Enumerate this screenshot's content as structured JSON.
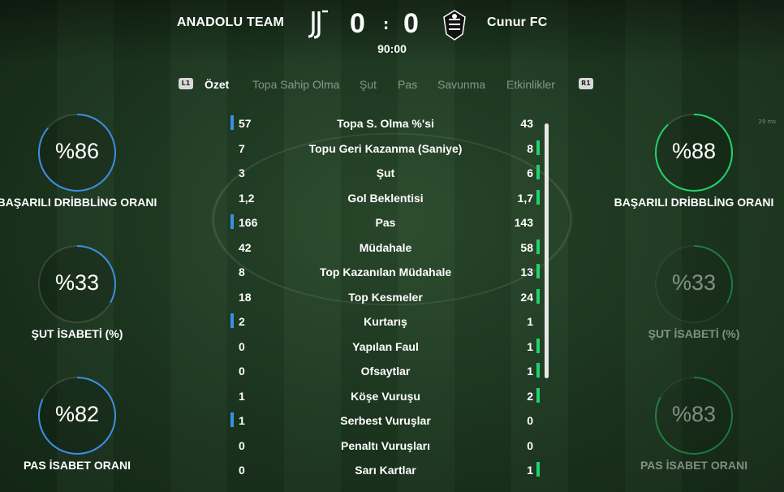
{
  "header": {
    "home_team": "ANADOLU TEAM",
    "away_team": "Cunur FC",
    "home_score": "0",
    "away_score": "0",
    "separator": ":",
    "clock": "90:00"
  },
  "tabs": {
    "bumper_left": "L1",
    "bumper_right": "R1",
    "items": [
      "Özet",
      "Topa Sahip Olma",
      "Şut",
      "Pas",
      "Savunma",
      "Etkinlikler"
    ],
    "active": "Özet"
  },
  "stats": [
    {
      "label": "Topa S. Olma %'si",
      "home": "57",
      "away": "43",
      "leader": "home"
    },
    {
      "label": "Topu Geri Kazanma (Saniye)",
      "home": "7",
      "away": "8",
      "leader": "away"
    },
    {
      "label": "Şut",
      "home": "3",
      "away": "6",
      "leader": "away"
    },
    {
      "label": "Gol Beklentisi",
      "home": "1,2",
      "away": "1,7",
      "leader": "away"
    },
    {
      "label": "Pas",
      "home": "166",
      "away": "143",
      "leader": "home"
    },
    {
      "label": "Müdahale",
      "home": "42",
      "away": "58",
      "leader": "away"
    },
    {
      "label": "Top Kazanılan Müdahale",
      "home": "8",
      "away": "13",
      "leader": "away"
    },
    {
      "label": "Top Kesmeler",
      "home": "18",
      "away": "24",
      "leader": "away"
    },
    {
      "label": "Kurtarış",
      "home": "2",
      "away": "1",
      "leader": "home"
    },
    {
      "label": "Yapılan Faul",
      "home": "0",
      "away": "1",
      "leader": "away"
    },
    {
      "label": "Ofsaytlar",
      "home": "0",
      "away": "1",
      "leader": "away"
    },
    {
      "label": "Köşe Vuruşu",
      "home": "1",
      "away": "2",
      "leader": "away"
    },
    {
      "label": "Serbest Vuruşlar",
      "home": "1",
      "away": "0",
      "leader": "home"
    },
    {
      "label": "Penaltı Vuruşları",
      "home": "0",
      "away": "0",
      "leader": "none"
    },
    {
      "label": "Sarı Kartlar",
      "home": "0",
      "away": "1",
      "leader": "away"
    }
  ],
  "home_rings": [
    {
      "value": "%86",
      "caption": "BAŞARILI DRİBBLİNG ORANI",
      "percent": 86
    },
    {
      "value": "%33",
      "caption": "ŞUT İSABETİ (%)",
      "percent": 33
    },
    {
      "value": "%82",
      "caption": "PAS İSABET ORANI",
      "percent": 82
    }
  ],
  "away_rings": [
    {
      "value": "%88",
      "caption": "BAŞARILI DRİBBLİNG ORANI",
      "percent": 88
    },
    {
      "value": "%33",
      "caption": "ŞUT İSABETİ (%)",
      "percent": 33
    },
    {
      "value": "%83",
      "caption": "PAS İSABET ORANI",
      "percent": 83
    }
  ],
  "colors": {
    "home_accent": "#3b8fe0",
    "away_accent": "#21d36b",
    "ring_track": "rgba(255,255,255,0.12)"
  },
  "overlay": {
    "fps_text": "29 ms"
  }
}
